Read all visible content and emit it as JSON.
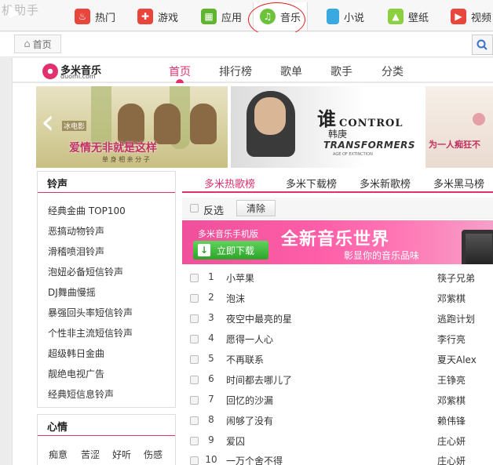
{
  "app": {
    "title": "机助手",
    "tabs": [
      {
        "label": "热门",
        "icon": "flame-icon",
        "color": "#e8453c"
      },
      {
        "label": "游戏",
        "icon": "gamepad-icon",
        "color": "#e8453c"
      },
      {
        "label": "应用",
        "icon": "apps-grid-icon",
        "color": "#5fb52d"
      },
      {
        "label": "音乐",
        "icon": "music-note-icon",
        "color": "#6cc23a"
      },
      {
        "label": "小说",
        "icon": "book-icon",
        "color": "#3aa9e0"
      },
      {
        "label": "壁纸",
        "icon": "wallpaper-icon",
        "color": "#8ccf3f"
      },
      {
        "label": "视频",
        "icon": "play-icon",
        "color": "#e8453c"
      }
    ],
    "home_label": "首页"
  },
  "site": {
    "logo_cn": "多米音乐",
    "logo_en": "duomi.com",
    "nav": [
      "首页",
      "排行榜",
      "歌单",
      "歌手",
      "分类"
    ],
    "accent": "#e0306d"
  },
  "banner": {
    "b1_tag": "冰电影",
    "b1_text": "爱情无非就是这样",
    "b1_sub": "单 身 相 亲 分 子",
    "b2_who": "谁",
    "b2_control": "CONTROL",
    "b2_name": "韩庚",
    "b2_tf": "TRANSFORMERS",
    "b2_age": "AGE OF EXTINCTION",
    "b3_text": "为一人痴狂不"
  },
  "ringtones": {
    "title": "铃声",
    "items": [
      "经典金曲 TOP100",
      "恶搞动物铃声",
      "滑稽喷泪铃声",
      "泡妞必备短信铃声",
      "DJ舞曲慢摇",
      "暴强回头率短信铃声",
      "个性非主流短信铃声",
      "超级韩日金曲",
      "靓绝电视广告",
      "经典短信息铃声"
    ]
  },
  "mood": {
    "title": "心情",
    "items": [
      "痴意",
      "苦涩",
      "好听",
      "伤感"
    ]
  },
  "charts": {
    "tabs": [
      "多米热歌榜",
      "多米下载榜",
      "多米新歌榜",
      "多米黑马榜"
    ],
    "invert_label": "反选",
    "clear_label": "清除"
  },
  "promo": {
    "app": "多米音乐手机版",
    "download": "立即下载",
    "big": "全新音乐世界",
    "small": "彰显你的音乐品味"
  },
  "songs": [
    {
      "num": "1",
      "title": "小苹果",
      "artist": "筷子兄弟"
    },
    {
      "num": "2",
      "title": "泡沫",
      "artist": "邓紫棋"
    },
    {
      "num": "3",
      "title": "夜空中最亮的星",
      "artist": "逃跑计划"
    },
    {
      "num": "4",
      "title": "愿得一人心",
      "artist": "李行亮"
    },
    {
      "num": "5",
      "title": "不再联系",
      "artist": "夏天Alex"
    },
    {
      "num": "6",
      "title": "时间都去哪儿了",
      "artist": "王铮亮"
    },
    {
      "num": "7",
      "title": "回忆的沙漏",
      "artist": "邓紫棋"
    },
    {
      "num": "8",
      "title": "闹够了没有",
      "artist": "赖伟锋"
    },
    {
      "num": "9",
      "title": "爱囚",
      "artist": "庄心妍"
    },
    {
      "num": "10",
      "title": "一万个舍不得",
      "artist": "庄心妍"
    }
  ]
}
